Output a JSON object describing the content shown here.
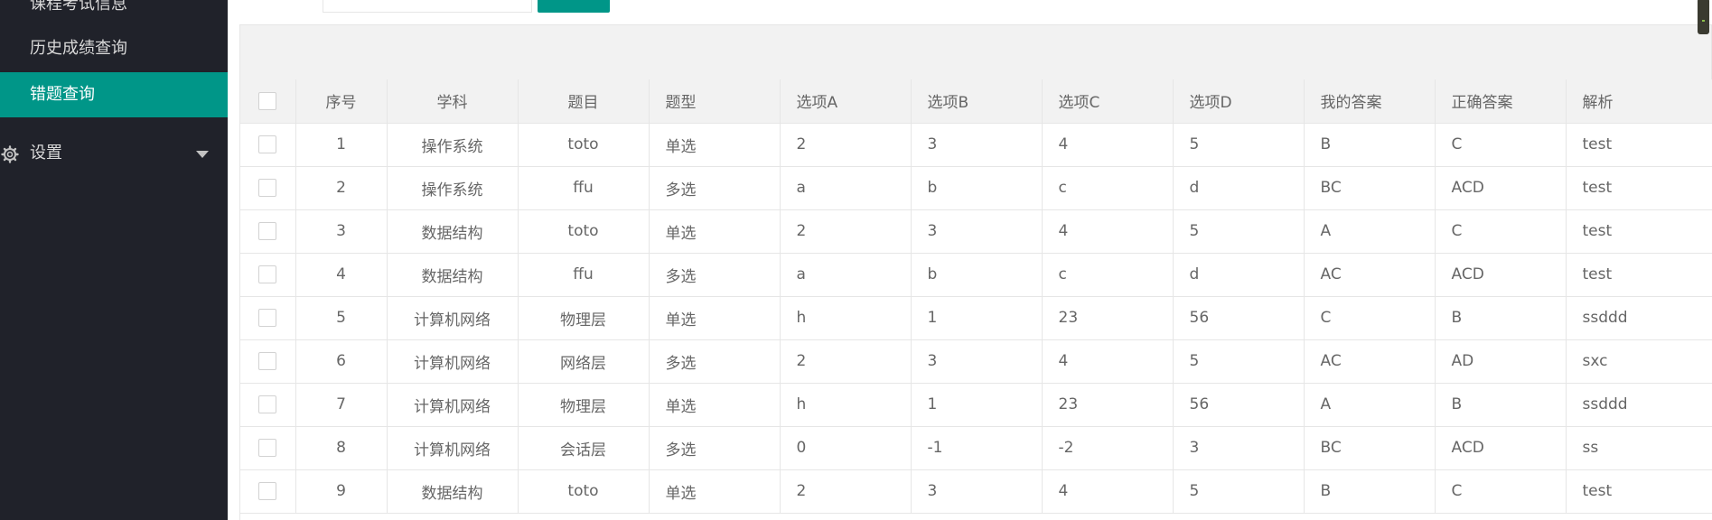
{
  "sidebar": {
    "items": [
      {
        "label": "课程考试信息"
      },
      {
        "label": "历史成绩查询"
      },
      {
        "label": "错题查询"
      },
      {
        "label": "设置"
      }
    ]
  },
  "colors": {
    "accent": "#009688",
    "sidebar_bg": "#20222a"
  },
  "table": {
    "headers": [
      "序号",
      "学科",
      "题目",
      "题型",
      "选项A",
      "选项B",
      "选项C",
      "选项D",
      "我的答案",
      "正确答案",
      "解析"
    ],
    "rows": [
      [
        "1",
        "操作系统",
        "toto",
        "单选",
        "2",
        "3",
        "4",
        "5",
        "B",
        "C",
        "test"
      ],
      [
        "2",
        "操作系统",
        "ffu",
        "多选",
        "a",
        "b",
        "c",
        "d",
        "BC",
        "ACD",
        "test"
      ],
      [
        "3",
        "数据结构",
        "toto",
        "单选",
        "2",
        "3",
        "4",
        "5",
        "A",
        "C",
        "test"
      ],
      [
        "4",
        "数据结构",
        "ffu",
        "多选",
        "a",
        "b",
        "c",
        "d",
        "AC",
        "ACD",
        "test"
      ],
      [
        "5",
        "计算机网络",
        "物理层",
        "单选",
        "h",
        "1",
        "23",
        "56",
        "C",
        "B",
        "ssddd"
      ],
      [
        "6",
        "计算机网络",
        "网络层",
        "多选",
        "2",
        "3",
        "4",
        "5",
        "AC",
        "AD",
        "sxc"
      ],
      [
        "7",
        "计算机网络",
        "物理层",
        "单选",
        "h",
        "1",
        "23",
        "56",
        "A",
        "B",
        "ssddd"
      ],
      [
        "8",
        "计算机网络",
        "会话层",
        "多选",
        "0",
        "-1",
        "-2",
        "3",
        "BC",
        "ACD",
        "ss"
      ],
      [
        "9",
        "数据结构",
        "toto",
        "单选",
        "2",
        "3",
        "4",
        "5",
        "B",
        "C",
        "test"
      ]
    ]
  }
}
